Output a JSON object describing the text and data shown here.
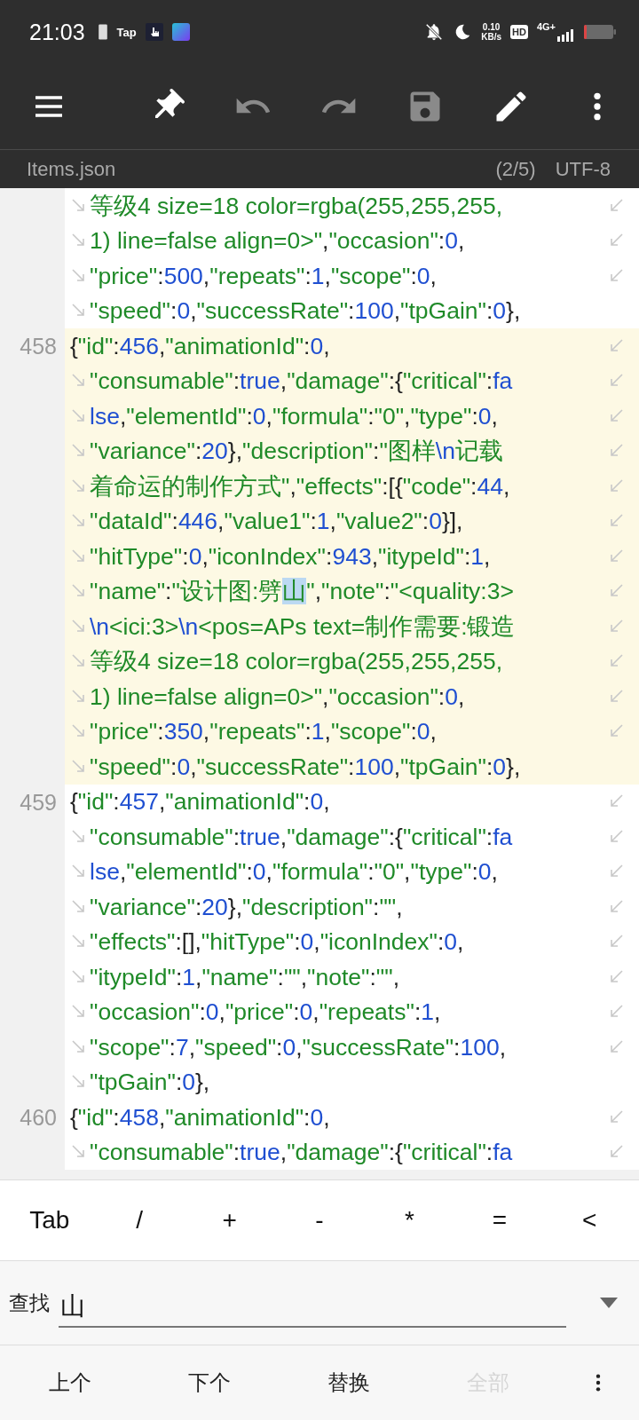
{
  "status_bar": {
    "time": "21:03",
    "app_label": "Tap",
    "net_speed": "0.10",
    "net_unit": "KB/s",
    "hd": "HD",
    "network": "4G+"
  },
  "toolbar": {
    "buttons": [
      {
        "kind": "menu",
        "disabled": false
      },
      {
        "kind": "pin",
        "disabled": false
      },
      {
        "kind": "undo",
        "disabled": true
      },
      {
        "kind": "redo",
        "disabled": true
      },
      {
        "kind": "save",
        "disabled": true
      },
      {
        "kind": "edit",
        "disabled": false
      },
      {
        "kind": "more",
        "disabled": false
      }
    ]
  },
  "file_bar": {
    "filename": "Items.json",
    "position": "(2/5)",
    "encoding": "UTF-8"
  },
  "code": {
    "blocks": [
      {
        "selected": false,
        "rows": [
          {
            "wrapped": true,
            "continues": true,
            "tokens": [
              {
                "kind": "string",
                "text": "等级4 size=18 color=rgba(255,255,255,"
              }
            ]
          },
          {
            "wrapped": true,
            "continues": true,
            "tokens": [
              {
                "kind": "string",
                "text": "1) line=false align=0>\""
              },
              {
                "kind": "punct",
                "text": ","
              },
              {
                "kind": "string",
                "text": "\"occasion\""
              },
              {
                "kind": "punct",
                "text": ":"
              },
              {
                "kind": "number",
                "text": "0"
              },
              {
                "kind": "punct",
                "text": ","
              }
            ]
          },
          {
            "wrapped": true,
            "continues": true,
            "tokens": [
              {
                "kind": "string",
                "text": "\"price\""
              },
              {
                "kind": "punct",
                "text": ":"
              },
              {
                "kind": "number",
                "text": "500"
              },
              {
                "kind": "punct",
                "text": ","
              },
              {
                "kind": "string",
                "text": "\"repeats\""
              },
              {
                "kind": "punct",
                "text": ":"
              },
              {
                "kind": "number",
                "text": "1"
              },
              {
                "kind": "punct",
                "text": ","
              },
              {
                "kind": "string",
                "text": "\"scope\""
              },
              {
                "kind": "punct",
                "text": ":"
              },
              {
                "kind": "number",
                "text": "0"
              },
              {
                "kind": "punct",
                "text": ","
              }
            ]
          },
          {
            "wrapped": true,
            "continues": false,
            "tokens": [
              {
                "kind": "string",
                "text": "\"speed\""
              },
              {
                "kind": "punct",
                "text": ":"
              },
              {
                "kind": "number",
                "text": "0"
              },
              {
                "kind": "punct",
                "text": ","
              },
              {
                "kind": "string",
                "text": "\"successRate\""
              },
              {
                "kind": "punct",
                "text": ":"
              },
              {
                "kind": "number",
                "text": "100"
              },
              {
                "kind": "punct",
                "text": ","
              },
              {
                "kind": "string",
                "text": "\"tpGain\""
              },
              {
                "kind": "punct",
                "text": ":"
              },
              {
                "kind": "number",
                "text": "0"
              },
              {
                "kind": "punct",
                "text": "},"
              }
            ]
          }
        ]
      },
      {
        "number": "458",
        "selected": true,
        "rows": [
          {
            "wrapped": false,
            "continues": true,
            "tokens": [
              {
                "kind": "punct",
                "text": "{"
              },
              {
                "kind": "string",
                "text": "\"id\""
              },
              {
                "kind": "punct",
                "text": ":"
              },
              {
                "kind": "number",
                "text": "456"
              },
              {
                "kind": "punct",
                "text": ","
              },
              {
                "kind": "string",
                "text": "\"animationId\""
              },
              {
                "kind": "punct",
                "text": ":"
              },
              {
                "kind": "number",
                "text": "0"
              },
              {
                "kind": "punct",
                "text": ","
              }
            ]
          },
          {
            "wrapped": true,
            "continues": true,
            "tokens": [
              {
                "kind": "string",
                "text": "\"consumable\""
              },
              {
                "kind": "punct",
                "text": ":"
              },
              {
                "kind": "number",
                "text": "true"
              },
              {
                "kind": "punct",
                "text": ","
              },
              {
                "kind": "string",
                "text": "\"damage\""
              },
              {
                "kind": "punct",
                "text": ":{"
              },
              {
                "kind": "string",
                "text": "\"critical\""
              },
              {
                "kind": "punct",
                "text": ":"
              },
              {
                "kind": "number",
                "text": "fa"
              }
            ]
          },
          {
            "wrapped": true,
            "continues": true,
            "tokens": [
              {
                "kind": "number",
                "text": "lse"
              },
              {
                "kind": "punct",
                "text": ","
              },
              {
                "kind": "string",
                "text": "\"elementId\""
              },
              {
                "kind": "punct",
                "text": ":"
              },
              {
                "kind": "number",
                "text": "0"
              },
              {
                "kind": "punct",
                "text": ","
              },
              {
                "kind": "string",
                "text": "\"formula\""
              },
              {
                "kind": "punct",
                "text": ":"
              },
              {
                "kind": "string",
                "text": "\"0\""
              },
              {
                "kind": "punct",
                "text": ","
              },
              {
                "kind": "string",
                "text": "\"type\""
              },
              {
                "kind": "punct",
                "text": ":"
              },
              {
                "kind": "number",
                "text": "0"
              },
              {
                "kind": "punct",
                "text": ","
              }
            ]
          },
          {
            "wrapped": true,
            "continues": true,
            "tokens": [
              {
                "kind": "string",
                "text": "\"variance\""
              },
              {
                "kind": "punct",
                "text": ":"
              },
              {
                "kind": "number",
                "text": "20"
              },
              {
                "kind": "punct",
                "text": "},"
              },
              {
                "kind": "string",
                "text": "\"description\""
              },
              {
                "kind": "punct",
                "text": ":"
              },
              {
                "kind": "string",
                "text": "\"图样"
              },
              {
                "kind": "number",
                "text": "\\n"
              },
              {
                "kind": "string",
                "text": "记载"
              }
            ]
          },
          {
            "wrapped": true,
            "continues": true,
            "tokens": [
              {
                "kind": "string",
                "text": "着命运的制作方式\""
              },
              {
                "kind": "punct",
                "text": ","
              },
              {
                "kind": "string",
                "text": "\"effects\""
              },
              {
                "kind": "punct",
                "text": ":[{"
              },
              {
                "kind": "string",
                "text": "\"code\""
              },
              {
                "kind": "punct",
                "text": ":"
              },
              {
                "kind": "number",
                "text": "44"
              },
              {
                "kind": "punct",
                "text": ","
              }
            ]
          },
          {
            "wrapped": true,
            "continues": true,
            "tokens": [
              {
                "kind": "string",
                "text": "\"dataId\""
              },
              {
                "kind": "punct",
                "text": ":"
              },
              {
                "kind": "number",
                "text": "446"
              },
              {
                "kind": "punct",
                "text": ","
              },
              {
                "kind": "string",
                "text": "\"value1\""
              },
              {
                "kind": "punct",
                "text": ":"
              },
              {
                "kind": "number",
                "text": "1"
              },
              {
                "kind": "punct",
                "text": ","
              },
              {
                "kind": "string",
                "text": "\"value2\""
              },
              {
                "kind": "punct",
                "text": ":"
              },
              {
                "kind": "number",
                "text": "0"
              },
              {
                "kind": "punct",
                "text": "}],"
              }
            ]
          },
          {
            "wrapped": true,
            "continues": true,
            "tokens": [
              {
                "kind": "string",
                "text": "\"hitType\""
              },
              {
                "kind": "punct",
                "text": ":"
              },
              {
                "kind": "number",
                "text": "0"
              },
              {
                "kind": "punct",
                "text": ","
              },
              {
                "kind": "string",
                "text": "\"iconIndex\""
              },
              {
                "kind": "punct",
                "text": ":"
              },
              {
                "kind": "number",
                "text": "943"
              },
              {
                "kind": "punct",
                "text": ","
              },
              {
                "kind": "string",
                "text": "\"itypeId\""
              },
              {
                "kind": "punct",
                "text": ":"
              },
              {
                "kind": "number",
                "text": "1"
              },
              {
                "kind": "punct",
                "text": ","
              }
            ]
          },
          {
            "wrapped": true,
            "continues": true,
            "tokens": [
              {
                "kind": "string",
                "text": "\"name\""
              },
              {
                "kind": "punct",
                "text": ":"
              },
              {
                "kind": "string",
                "text": "\"设计图:劈"
              },
              {
                "kind": "match",
                "text": "山"
              },
              {
                "kind": "string",
                "text": "\""
              },
              {
                "kind": "punct",
                "text": ","
              },
              {
                "kind": "string",
                "text": "\"note\""
              },
              {
                "kind": "punct",
                "text": ":"
              },
              {
                "kind": "string",
                "text": "\"<quality:3>"
              }
            ]
          },
          {
            "wrapped": true,
            "continues": true,
            "tokens": [
              {
                "kind": "number",
                "text": "\\n"
              },
              {
                "kind": "string",
                "text": "<ici:3>"
              },
              {
                "kind": "number",
                "text": "\\n"
              },
              {
                "kind": "string",
                "text": "<pos=APs text=制作需要:锻造"
              }
            ]
          },
          {
            "wrapped": true,
            "continues": true,
            "tokens": [
              {
                "kind": "string",
                "text": "等级4 size=18 color=rgba(255,255,255,"
              }
            ]
          },
          {
            "wrapped": true,
            "continues": true,
            "tokens": [
              {
                "kind": "string",
                "text": "1) line=false align=0>\""
              },
              {
                "kind": "punct",
                "text": ","
              },
              {
                "kind": "string",
                "text": "\"occasion\""
              },
              {
                "kind": "punct",
                "text": ":"
              },
              {
                "kind": "number",
                "text": "0"
              },
              {
                "kind": "punct",
                "text": ","
              }
            ]
          },
          {
            "wrapped": true,
            "continues": true,
            "tokens": [
              {
                "kind": "string",
                "text": "\"price\""
              },
              {
                "kind": "punct",
                "text": ":"
              },
              {
                "kind": "number",
                "text": "350"
              },
              {
                "kind": "punct",
                "text": ","
              },
              {
                "kind": "string",
                "text": "\"repeats\""
              },
              {
                "kind": "punct",
                "text": ":"
              },
              {
                "kind": "number",
                "text": "1"
              },
              {
                "kind": "punct",
                "text": ","
              },
              {
                "kind": "string",
                "text": "\"scope\""
              },
              {
                "kind": "punct",
                "text": ":"
              },
              {
                "kind": "number",
                "text": "0"
              },
              {
                "kind": "punct",
                "text": ","
              }
            ]
          },
          {
            "wrapped": true,
            "continues": false,
            "tokens": [
              {
                "kind": "string",
                "text": "\"speed\""
              },
              {
                "kind": "punct",
                "text": ":"
              },
              {
                "kind": "number",
                "text": "0"
              },
              {
                "kind": "punct",
                "text": ","
              },
              {
                "kind": "string",
                "text": "\"successRate\""
              },
              {
                "kind": "punct",
                "text": ":"
              },
              {
                "kind": "number",
                "text": "100"
              },
              {
                "kind": "punct",
                "text": ","
              },
              {
                "kind": "string",
                "text": "\"tpGain\""
              },
              {
                "kind": "punct",
                "text": ":"
              },
              {
                "kind": "number",
                "text": "0"
              },
              {
                "kind": "punct",
                "text": "},"
              }
            ]
          }
        ]
      },
      {
        "number": "459",
        "selected": false,
        "rows": [
          {
            "wrapped": false,
            "continues": true,
            "tokens": [
              {
                "kind": "punct",
                "text": "{"
              },
              {
                "kind": "string",
                "text": "\"id\""
              },
              {
                "kind": "punct",
                "text": ":"
              },
              {
                "kind": "number",
                "text": "457"
              },
              {
                "kind": "punct",
                "text": ","
              },
              {
                "kind": "string",
                "text": "\"animationId\""
              },
              {
                "kind": "punct",
                "text": ":"
              },
              {
                "kind": "number",
                "text": "0"
              },
              {
                "kind": "punct",
                "text": ","
              }
            ]
          },
          {
            "wrapped": true,
            "continues": true,
            "tokens": [
              {
                "kind": "string",
                "text": "\"consumable\""
              },
              {
                "kind": "punct",
                "text": ":"
              },
              {
                "kind": "number",
                "text": "true"
              },
              {
                "kind": "punct",
                "text": ","
              },
              {
                "kind": "string",
                "text": "\"damage\""
              },
              {
                "kind": "punct",
                "text": ":{"
              },
              {
                "kind": "string",
                "text": "\"critical\""
              },
              {
                "kind": "punct",
                "text": ":"
              },
              {
                "kind": "number",
                "text": "fa"
              }
            ]
          },
          {
            "wrapped": true,
            "continues": true,
            "tokens": [
              {
                "kind": "number",
                "text": "lse"
              },
              {
                "kind": "punct",
                "text": ","
              },
              {
                "kind": "string",
                "text": "\"elementId\""
              },
              {
                "kind": "punct",
                "text": ":"
              },
              {
                "kind": "number",
                "text": "0"
              },
              {
                "kind": "punct",
                "text": ","
              },
              {
                "kind": "string",
                "text": "\"formula\""
              },
              {
                "kind": "punct",
                "text": ":"
              },
              {
                "kind": "string",
                "text": "\"0\""
              },
              {
                "kind": "punct",
                "text": ","
              },
              {
                "kind": "string",
                "text": "\"type\""
              },
              {
                "kind": "punct",
                "text": ":"
              },
              {
                "kind": "number",
                "text": "0"
              },
              {
                "kind": "punct",
                "text": ","
              }
            ]
          },
          {
            "wrapped": true,
            "continues": true,
            "tokens": [
              {
                "kind": "string",
                "text": "\"variance\""
              },
              {
                "kind": "punct",
                "text": ":"
              },
              {
                "kind": "number",
                "text": "20"
              },
              {
                "kind": "punct",
                "text": "},"
              },
              {
                "kind": "string",
                "text": "\"description\""
              },
              {
                "kind": "punct",
                "text": ":"
              },
              {
                "kind": "string",
                "text": "\"\""
              },
              {
                "kind": "punct",
                "text": ","
              }
            ]
          },
          {
            "wrapped": true,
            "continues": true,
            "tokens": [
              {
                "kind": "string",
                "text": "\"effects\""
              },
              {
                "kind": "punct",
                "text": ":[],"
              },
              {
                "kind": "string",
                "text": "\"hitType\""
              },
              {
                "kind": "punct",
                "text": ":"
              },
              {
                "kind": "number",
                "text": "0"
              },
              {
                "kind": "punct",
                "text": ","
              },
              {
                "kind": "string",
                "text": "\"iconIndex\""
              },
              {
                "kind": "punct",
                "text": ":"
              },
              {
                "kind": "number",
                "text": "0"
              },
              {
                "kind": "punct",
                "text": ","
              }
            ]
          },
          {
            "wrapped": true,
            "continues": true,
            "tokens": [
              {
                "kind": "string",
                "text": "\"itypeId\""
              },
              {
                "kind": "punct",
                "text": ":"
              },
              {
                "kind": "number",
                "text": "1"
              },
              {
                "kind": "punct",
                "text": ","
              },
              {
                "kind": "string",
                "text": "\"name\""
              },
              {
                "kind": "punct",
                "text": ":"
              },
              {
                "kind": "string",
                "text": "\"\""
              },
              {
                "kind": "punct",
                "text": ","
              },
              {
                "kind": "string",
                "text": "\"note\""
              },
              {
                "kind": "punct",
                "text": ":"
              },
              {
                "kind": "string",
                "text": "\"\""
              },
              {
                "kind": "punct",
                "text": ","
              }
            ]
          },
          {
            "wrapped": true,
            "continues": true,
            "tokens": [
              {
                "kind": "string",
                "text": "\"occasion\""
              },
              {
                "kind": "punct",
                "text": ":"
              },
              {
                "kind": "number",
                "text": "0"
              },
              {
                "kind": "punct",
                "text": ","
              },
              {
                "kind": "string",
                "text": "\"price\""
              },
              {
                "kind": "punct",
                "text": ":"
              },
              {
                "kind": "number",
                "text": "0"
              },
              {
                "kind": "punct",
                "text": ","
              },
              {
                "kind": "string",
                "text": "\"repeats\""
              },
              {
                "kind": "punct",
                "text": ":"
              },
              {
                "kind": "number",
                "text": "1"
              },
              {
                "kind": "punct",
                "text": ","
              }
            ]
          },
          {
            "wrapped": true,
            "continues": true,
            "tokens": [
              {
                "kind": "string",
                "text": "\"scope\""
              },
              {
                "kind": "punct",
                "text": ":"
              },
              {
                "kind": "number",
                "text": "7"
              },
              {
                "kind": "punct",
                "text": ","
              },
              {
                "kind": "string",
                "text": "\"speed\""
              },
              {
                "kind": "punct",
                "text": ":"
              },
              {
                "kind": "number",
                "text": "0"
              },
              {
                "kind": "punct",
                "text": ","
              },
              {
                "kind": "string",
                "text": "\"successRate\""
              },
              {
                "kind": "punct",
                "text": ":"
              },
              {
                "kind": "number",
                "text": "100"
              },
              {
                "kind": "punct",
                "text": ","
              }
            ]
          },
          {
            "wrapped": true,
            "continues": false,
            "tokens": [
              {
                "kind": "string",
                "text": "\"tpGain\""
              },
              {
                "kind": "punct",
                "text": ":"
              },
              {
                "kind": "number",
                "text": "0"
              },
              {
                "kind": "punct",
                "text": "},"
              }
            ]
          }
        ]
      },
      {
        "number": "460",
        "selected": false,
        "rows": [
          {
            "wrapped": false,
            "continues": true,
            "tokens": [
              {
                "kind": "punct",
                "text": "{"
              },
              {
                "kind": "string",
                "text": "\"id\""
              },
              {
                "kind": "punct",
                "text": ":"
              },
              {
                "kind": "number",
                "text": "458"
              },
              {
                "kind": "punct",
                "text": ","
              },
              {
                "kind": "string",
                "text": "\"animationId\""
              },
              {
                "kind": "punct",
                "text": ":"
              },
              {
                "kind": "number",
                "text": "0"
              },
              {
                "kind": "punct",
                "text": ","
              }
            ]
          },
          {
            "wrapped": true,
            "continues": true,
            "tokens": [
              {
                "kind": "string",
                "text": "\"consumable\""
              },
              {
                "kind": "punct",
                "text": ":"
              },
              {
                "kind": "number",
                "text": "true"
              },
              {
                "kind": "punct",
                "text": ","
              },
              {
                "kind": "string",
                "text": "\"damage\""
              },
              {
                "kind": "punct",
                "text": ":{"
              },
              {
                "kind": "string",
                "text": "\"critical\""
              },
              {
                "kind": "punct",
                "text": ":"
              },
              {
                "kind": "number",
                "text": "fa"
              }
            ]
          }
        ]
      }
    ]
  },
  "symbol_keys": [
    "Tab",
    "/",
    "+",
    "-",
    "*",
    "=",
    "<"
  ],
  "find_bar": {
    "label": "查找",
    "value": "山"
  },
  "find_actions": [
    {
      "label": "上个",
      "disabled": false
    },
    {
      "label": "下个",
      "disabled": false
    },
    {
      "label": "替换",
      "disabled": false
    },
    {
      "label": "全部",
      "disabled": true
    }
  ]
}
